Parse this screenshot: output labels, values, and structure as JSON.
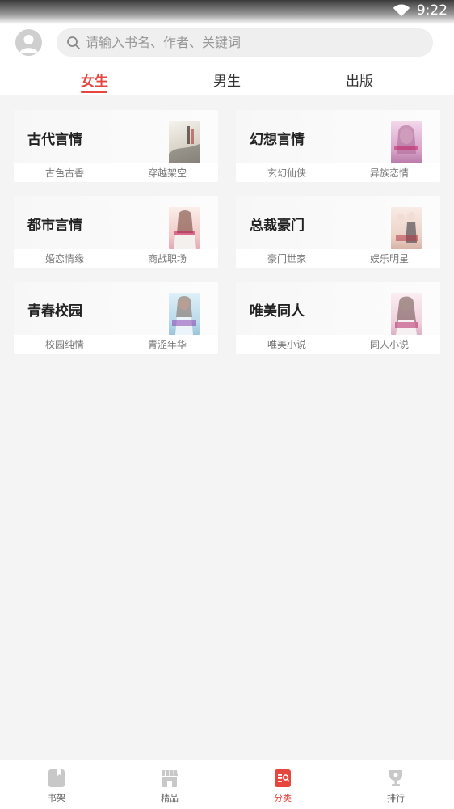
{
  "status_bar": {
    "time": "9:22"
  },
  "header": {
    "search_placeholder": "请输入书名、作者、关键词"
  },
  "tabs": [
    {
      "label": "女生",
      "active": true
    },
    {
      "label": "男生",
      "active": false
    },
    {
      "label": "出版",
      "active": false
    }
  ],
  "categories": [
    {
      "title": "古代言情",
      "tags": [
        "古色古香",
        "穿越架空"
      ],
      "cover_color": "#e8e4dc"
    },
    {
      "title": "幻想言情",
      "tags": [
        "玄幻仙侠",
        "异族恋情"
      ],
      "cover_color": "#e7c6dc"
    },
    {
      "title": "都市言情",
      "tags": [
        "婚恋情缘",
        "商战职场"
      ],
      "cover_color": "#f1dbd6"
    },
    {
      "title": "总裁豪门",
      "tags": [
        "豪门世家",
        "娱乐明星"
      ],
      "cover_color": "#efd9cf"
    },
    {
      "title": "青春校园",
      "tags": [
        "校园纯情",
        "青涩年华"
      ],
      "cover_color": "#cfe3ef"
    },
    {
      "title": "唯美同人",
      "tags": [
        "唯美小说",
        "同人小说"
      ],
      "cover_color": "#f0dce4"
    }
  ],
  "bottom_nav": [
    {
      "label": "书架",
      "icon": "bookshelf-icon",
      "active": false
    },
    {
      "label": "精品",
      "icon": "store-icon",
      "active": false
    },
    {
      "label": "分类",
      "icon": "category-icon",
      "active": true
    },
    {
      "label": "排行",
      "icon": "trophy-icon",
      "active": false
    }
  ],
  "colors": {
    "accent": "#e5463e",
    "background": "#f4f4f4"
  }
}
